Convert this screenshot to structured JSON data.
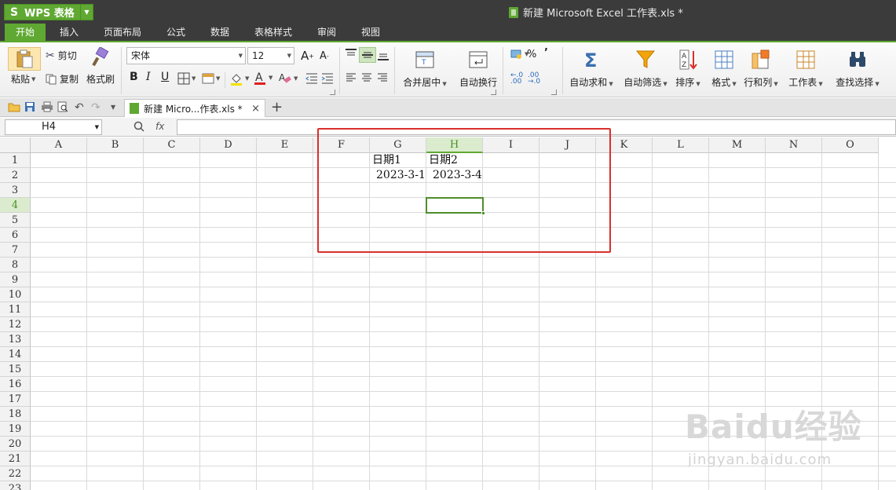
{
  "app": {
    "name": "WPS 表格",
    "logo_letter": "S",
    "doc_title": "新建 Microsoft Excel 工作表.xls *",
    "accent_color": "#5fa832",
    "titlebar_color": "#3b3b3b"
  },
  "menu": {
    "tabs": [
      "开始",
      "插入",
      "页面布局",
      "公式",
      "数据",
      "表格样式",
      "审阅",
      "视图"
    ],
    "active": "开始"
  },
  "ribbon": {
    "paste": "粘贴",
    "cut": "剪切",
    "copy": "复制",
    "format_painter": "格式刷",
    "font_name": "宋体",
    "font_size": "12",
    "bold": "B",
    "italic": "I",
    "underline": "U",
    "grow_font": "A",
    "shrink_font": "A",
    "merge_center": "合并居中",
    "wrap_text": "自动换行",
    "percent": "%",
    "comma": "’",
    "autosum": "自动求和",
    "autofilter": "自动筛选",
    "sort": "排序",
    "format": "格式",
    "rows_cols": "行和列",
    "worksheet": "工作表",
    "find_select": "查找选择"
  },
  "doc_tab": {
    "label": "新建 Micro...作表.xls *",
    "close": "×",
    "new_tab": "+"
  },
  "formula_bar": {
    "name_box": "H4",
    "fx": "fx",
    "value": ""
  },
  "sheet": {
    "columns": [
      "A",
      "B",
      "C",
      "D",
      "E",
      "F",
      "G",
      "H",
      "I",
      "J",
      "K",
      "L",
      "M",
      "N",
      "O"
    ],
    "rows": [
      "1",
      "2",
      "3",
      "4",
      "5",
      "6",
      "7",
      "8",
      "9",
      "10",
      "11",
      "12",
      "13",
      "14",
      "15",
      "16",
      "17",
      "18",
      "19",
      "20",
      "21",
      "22",
      "23"
    ],
    "selected_column": "H",
    "selected_row": "4",
    "cells": {
      "G1": "日期1",
      "H1": "日期2",
      "G2": "2023-3-1",
      "H2": "2023-3-4"
    },
    "highlight_color": "#d9302c"
  },
  "watermark": {
    "main": "Baidu经验",
    "sub": "jingyan.baidu.com"
  }
}
